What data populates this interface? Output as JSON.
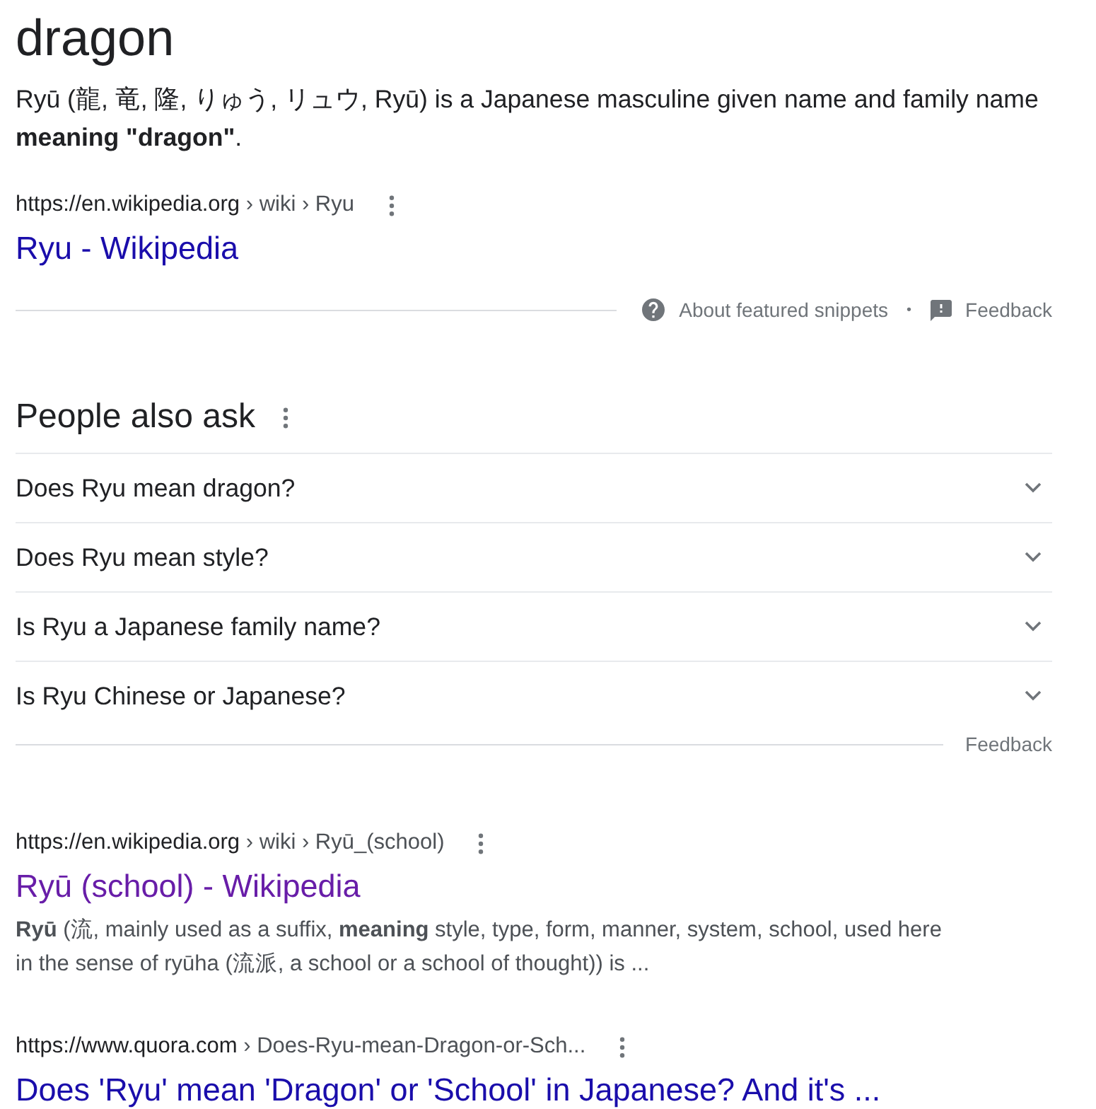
{
  "query_heading": "dragon",
  "featured_snippet": {
    "text": "Ryū (龍, 竜, 隆, りゅう, リュウ, Ryū) is a Japanese masculine given name and family name **meaning \"dragon\"**.",
    "source": {
      "site": "https://en.wikipedia.org",
      "path": "› wiki › Ryu",
      "title": "Ryu - Wikipedia",
      "visited": false
    },
    "footer": {
      "about": "About featured snippets",
      "separator": "•",
      "feedback": "Feedback"
    }
  },
  "people_also_ask": {
    "heading": "People also ask",
    "questions": [
      {
        "text": "Does Ryu mean dragon?",
        "expanded": false
      },
      {
        "text": "Does Ryu mean style?",
        "expanded": false
      },
      {
        "text": "Is Ryu a Japanese family name?",
        "expanded": false
      },
      {
        "text": "Is Ryu Chinese or Japanese?",
        "expanded": false
      }
    ],
    "feedback": "Feedback"
  },
  "results": [
    {
      "site": "https://en.wikipedia.org",
      "path": "› wiki › Ryū_(school)",
      "title": "Ryū (school) - Wikipedia",
      "visited": true,
      "snippet": "**Ryū** (流, mainly used as a suffix, **meaning** style, type, form, manner, system, school, used here in the sense of ryūha (流派, a school or a school of thought)) is ..."
    },
    {
      "site": "https://www.quora.com",
      "path": "› Does-Ryu-mean-Dragon-or-Sch...",
      "title": "Does 'Ryu' mean 'Dragon' or 'School' in Japanese? And it's ...",
      "visited": false
    }
  ]
}
